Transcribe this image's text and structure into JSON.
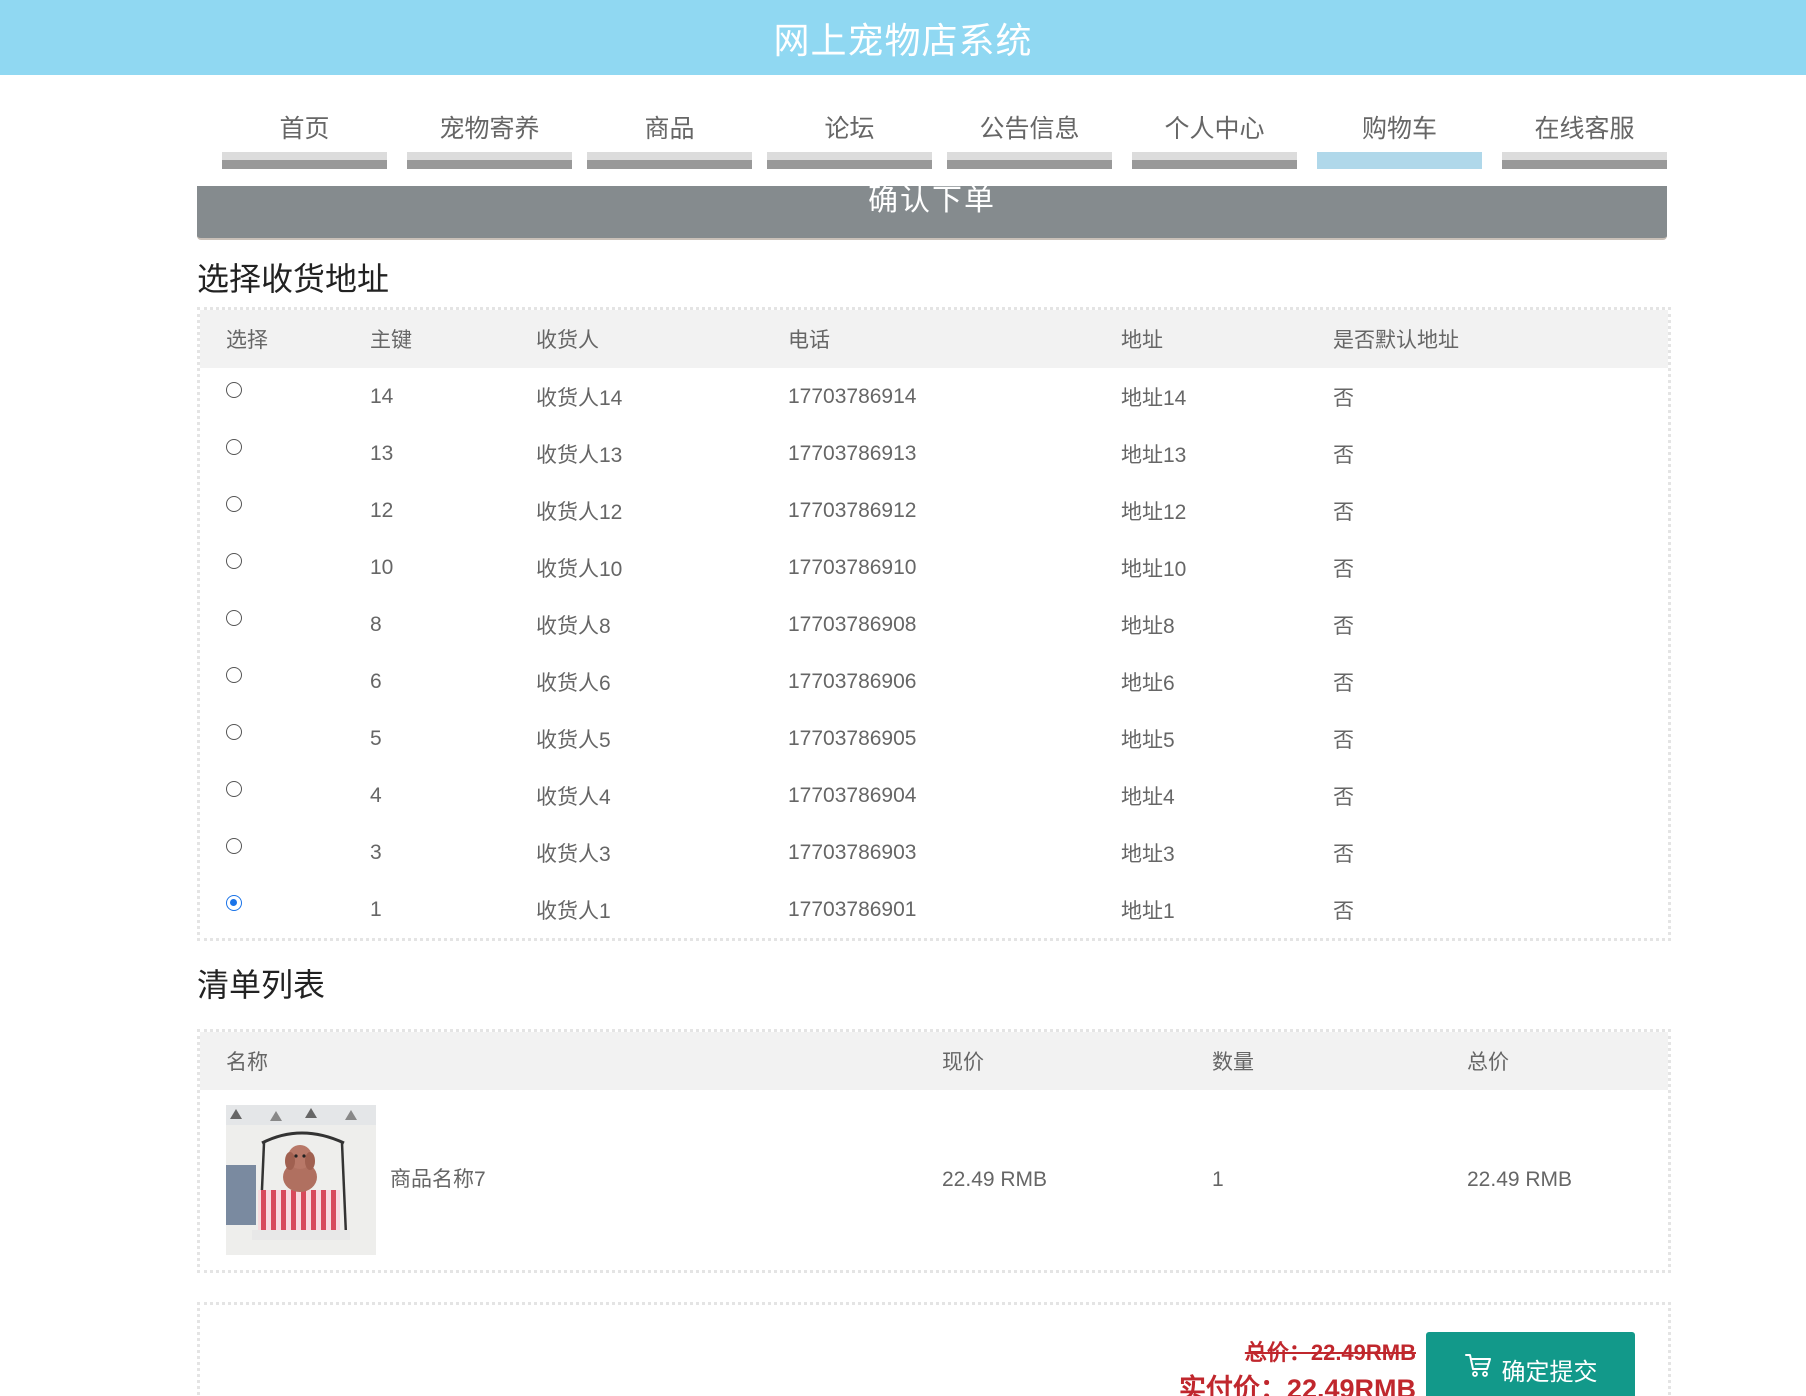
{
  "header": {
    "title": "网上宠物店系统"
  },
  "nav": {
    "items": [
      {
        "label": "首页",
        "active": false
      },
      {
        "label": "宠物寄养",
        "active": false
      },
      {
        "label": "商品",
        "active": false
      },
      {
        "label": "论坛",
        "active": false
      },
      {
        "label": "公告信息",
        "active": false
      },
      {
        "label": "个人中心",
        "active": false
      },
      {
        "label": "购物车",
        "active": true
      },
      {
        "label": "在线客服",
        "active": false
      }
    ]
  },
  "banner": {
    "title": "确认下单"
  },
  "address_section": {
    "title": "选择收货地址",
    "columns": [
      "选择",
      "主键",
      "收货人",
      "电话",
      "地址",
      "是否默认地址"
    ],
    "rows": [
      {
        "id": "14",
        "name": "收货人14",
        "phone": "17703786914",
        "address": "地址14",
        "default": "否",
        "selected": false
      },
      {
        "id": "13",
        "name": "收货人13",
        "phone": "17703786913",
        "address": "地址13",
        "default": "否",
        "selected": false
      },
      {
        "id": "12",
        "name": "收货人12",
        "phone": "17703786912",
        "address": "地址12",
        "default": "否",
        "selected": false
      },
      {
        "id": "10",
        "name": "收货人10",
        "phone": "17703786910",
        "address": "地址10",
        "default": "否",
        "selected": false
      },
      {
        "id": "8",
        "name": "收货人8",
        "phone": "17703786908",
        "address": "地址8",
        "default": "否",
        "selected": false
      },
      {
        "id": "6",
        "name": "收货人6",
        "phone": "17703786906",
        "address": "地址6",
        "default": "否",
        "selected": false
      },
      {
        "id": "5",
        "name": "收货人5",
        "phone": "17703786905",
        "address": "地址5",
        "default": "否",
        "selected": false
      },
      {
        "id": "4",
        "name": "收货人4",
        "phone": "17703786904",
        "address": "地址4",
        "default": "否",
        "selected": false
      },
      {
        "id": "3",
        "name": "收货人3",
        "phone": "17703786903",
        "address": "地址3",
        "default": "否",
        "selected": false
      },
      {
        "id": "1",
        "name": "收货人1",
        "phone": "17703786901",
        "address": "地址1",
        "default": "否",
        "selected": true
      }
    ]
  },
  "order_section": {
    "title": "清单列表",
    "columns": [
      "名称",
      "现价",
      "数量",
      "总价"
    ],
    "rows": [
      {
        "name": "商品名称7",
        "price": "22.49 RMB",
        "qty": "1",
        "total": "22.49 RMB",
        "image": "poodle-on-swing-photo"
      }
    ]
  },
  "summary": {
    "total_label": "总价：22.49RMB",
    "paid_label": "实付价：22.49RMB",
    "submit_label": "确定提交",
    "submit_icon": "cart-icon",
    "price_color": "#c0272d",
    "button_color": "#12998a"
  },
  "colors": {
    "header_bg": "#90d8f2",
    "nav_active_bar": "#b0d8ea",
    "banner_bg": "#858b8e"
  }
}
